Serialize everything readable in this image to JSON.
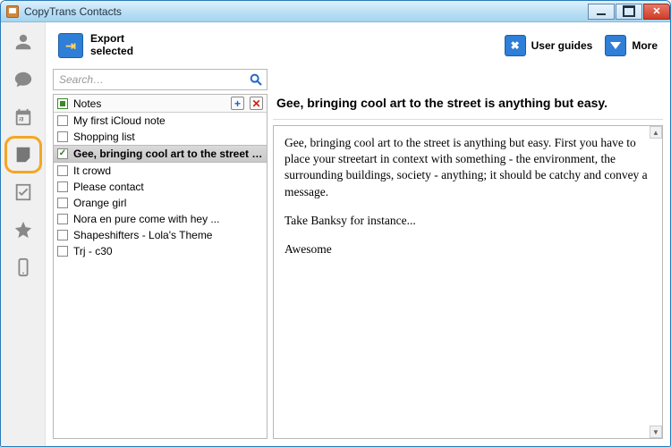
{
  "app": {
    "title": "CopyTrans Contacts"
  },
  "toolbar": {
    "export_label": "Export\nselected",
    "user_guides": "User guides",
    "more": "More"
  },
  "search": {
    "placeholder": "Search…"
  },
  "list": {
    "header": "Notes",
    "selected_index": 2,
    "items": [
      {
        "label": "My first iCloud note",
        "checked": false
      },
      {
        "label": "Shopping list",
        "checked": false
      },
      {
        "label": "Gee, bringing cool art to the street is a...",
        "checked": true
      },
      {
        "label": "It crowd",
        "checked": false
      },
      {
        "label": "Please contact",
        "checked": false
      },
      {
        "label": "Orange girl",
        "checked": false
      },
      {
        "label": "Nora en pure come with hey  ...",
        "checked": false
      },
      {
        "label": "Shapeshifters - Lola's Theme",
        "checked": false
      },
      {
        "label": "Trj - c30",
        "checked": false
      }
    ]
  },
  "preview": {
    "title": "Gee, bringing cool art to the street is anything but easy.",
    "paragraphs": [
      "Gee, bringing cool art to the street is anything but easy. First you have to place your streetart in context with something - the environment, the surrounding buildings, society - anything; it should be catchy and convey a message.",
      "Take Banksy for instance...",
      "Awesome"
    ]
  },
  "rail": {
    "items": [
      "contacts",
      "messages",
      "calendar",
      "notes",
      "tasks",
      "favorites",
      "device"
    ],
    "active": "notes"
  }
}
